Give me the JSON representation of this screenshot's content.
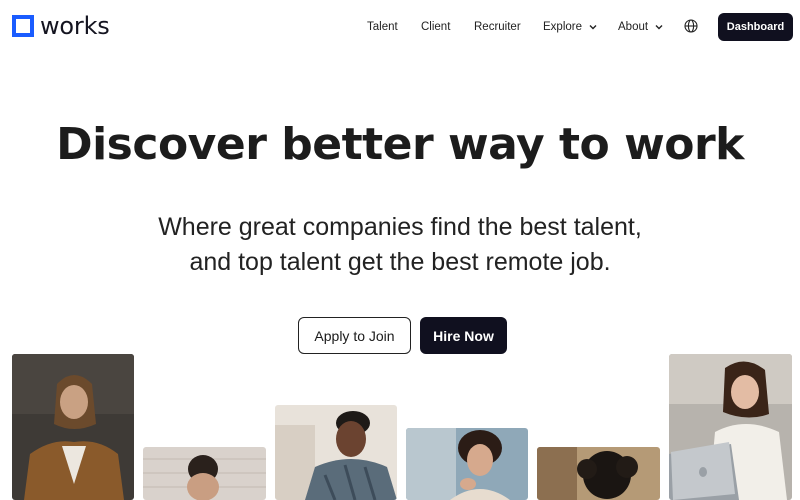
{
  "brand": {
    "name": "works",
    "accent": "#1a5cff"
  },
  "nav": {
    "items": [
      {
        "label": "Talent",
        "dropdown": false
      },
      {
        "label": "Client",
        "dropdown": false
      },
      {
        "label": "Recruiter",
        "dropdown": false
      },
      {
        "label": "Explore",
        "dropdown": true
      },
      {
        "label": "About",
        "dropdown": true
      }
    ],
    "language_icon": "globe-icon",
    "dashboard_label": "Dashboard"
  },
  "hero": {
    "title_pre": "Discover ",
    "title_bold": "better way",
    "title_post": " to work",
    "subtitle_line1": "Where great companies find the best talent,",
    "subtitle_line2": "and top talent get the best remote job.",
    "apply_label": "Apply to Join",
    "hire_label": "Hire Now"
  },
  "photos": [
    {
      "subject": "man with long hair in brown jacket"
    },
    {
      "subject": "man with hair bun, head lowered"
    },
    {
      "subject": "man in plaid shirt working on laptop"
    },
    {
      "subject": "woman with curly hair resting chin on hand"
    },
    {
      "subject": "person with curly dark hair"
    },
    {
      "subject": "woman smiling working on laptop"
    }
  ],
  "colors": {
    "primary_dark": "#10101f",
    "text": "#1c1c1c",
    "background": "#ffffff"
  }
}
